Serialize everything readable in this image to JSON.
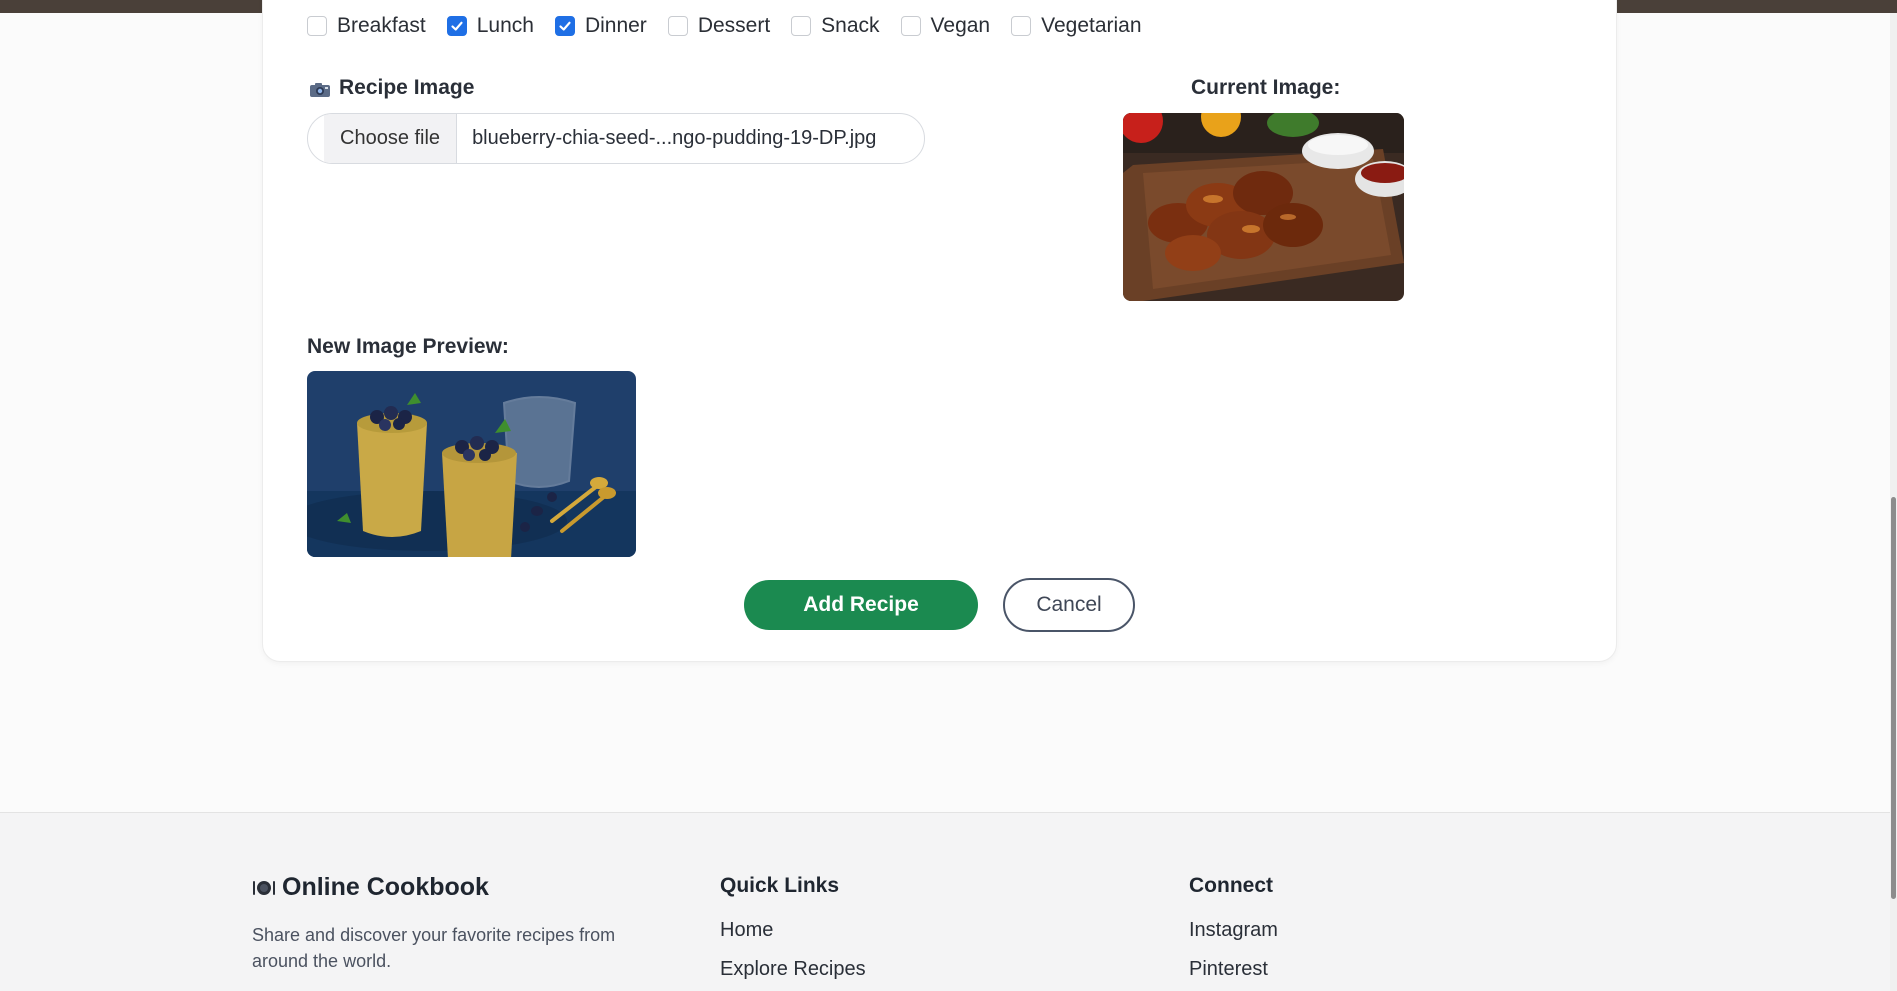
{
  "categories": [
    {
      "label": "Breakfast",
      "checked": false
    },
    {
      "label": "Lunch",
      "checked": true
    },
    {
      "label": "Dinner",
      "checked": true
    },
    {
      "label": "Dessert",
      "checked": false
    },
    {
      "label": "Snack",
      "checked": false
    },
    {
      "label": "Vegan",
      "checked": false
    },
    {
      "label": "Vegetarian",
      "checked": false
    }
  ],
  "recipe_image": {
    "label": "Recipe Image",
    "choose_button": "Choose file",
    "file_name": "blueberry-chia-seed-...ngo-pudding-19-DP.jpg"
  },
  "current_image": {
    "label": "Current Image:"
  },
  "new_preview": {
    "label": "New Image Preview:"
  },
  "actions": {
    "add": "Add Recipe",
    "cancel": "Cancel"
  },
  "footer": {
    "brand": "Online Cookbook",
    "description": "Share and discover your favorite recipes from around the world.",
    "quick_links": {
      "heading": "Quick Links",
      "items": [
        "Home",
        "Explore Recipes"
      ]
    },
    "connect": {
      "heading": "Connect",
      "items": [
        "Instagram",
        "Pinterest"
      ]
    }
  },
  "colors": {
    "primary": "#1b8a50",
    "checkbox": "#1f6fe5",
    "top_bar": "#4a4039"
  },
  "icons": {
    "recipe_image": "camera-icon",
    "brand": "plate-icon",
    "checked": "check-icon"
  }
}
